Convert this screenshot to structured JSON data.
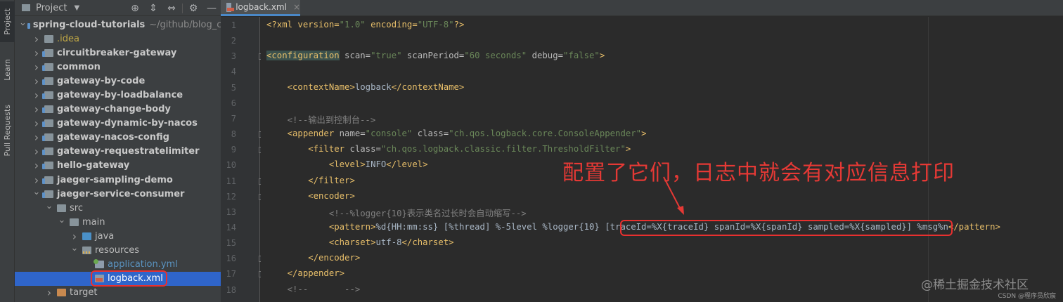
{
  "toolstrip": {
    "tabs": [
      {
        "label": "Project",
        "icon": "folder-icon"
      },
      {
        "label": "Learn",
        "icon": "graduation-cap-icon"
      },
      {
        "label": "Pull Requests",
        "icon": "pull-request-icon"
      }
    ]
  },
  "project_panel": {
    "title": "Project",
    "tree": [
      {
        "label": "spring-cloud-tutorials",
        "path": "~/github/blog_c",
        "arrow": "open",
        "depth": 0,
        "icon": "module",
        "style": "bold"
      },
      {
        "label": ".idea",
        "arrow": "closed",
        "depth": 1,
        "icon": "folder",
        "style": "idea"
      },
      {
        "label": "circuitbreaker-gateway",
        "arrow": "closed",
        "depth": 1,
        "icon": "module",
        "style": "bold"
      },
      {
        "label": "common",
        "arrow": "closed",
        "depth": 1,
        "icon": "module",
        "style": "bold"
      },
      {
        "label": "gateway-by-code",
        "arrow": "closed",
        "depth": 1,
        "icon": "module",
        "style": "bold"
      },
      {
        "label": "gateway-by-loadbalance",
        "arrow": "closed",
        "depth": 1,
        "icon": "module",
        "style": "bold"
      },
      {
        "label": "gateway-change-body",
        "arrow": "closed",
        "depth": 1,
        "icon": "module",
        "style": "bold"
      },
      {
        "label": "gateway-dynamic-by-nacos",
        "arrow": "closed",
        "depth": 1,
        "icon": "module",
        "style": "bold"
      },
      {
        "label": "gateway-nacos-config",
        "arrow": "closed",
        "depth": 1,
        "icon": "module",
        "style": "bold"
      },
      {
        "label": "gateway-requestratelimiter",
        "arrow": "closed",
        "depth": 1,
        "icon": "module",
        "style": "bold"
      },
      {
        "label": "hello-gateway",
        "arrow": "closed",
        "depth": 1,
        "icon": "module",
        "style": "bold"
      },
      {
        "label": "jaeger-sampling-demo",
        "arrow": "closed",
        "depth": 1,
        "icon": "module",
        "style": "bold"
      },
      {
        "label": "jaeger-service-consumer",
        "arrow": "open",
        "depth": 1,
        "icon": "module",
        "style": "bold"
      },
      {
        "label": "src",
        "arrow": "open",
        "depth": 2,
        "icon": "folder",
        "style": "normal"
      },
      {
        "label": "main",
        "arrow": "open",
        "depth": 3,
        "icon": "folder",
        "style": "normal"
      },
      {
        "label": "java",
        "arrow": "closed",
        "depth": 4,
        "icon": "blue",
        "style": "normal"
      },
      {
        "label": "resources",
        "arrow": "open",
        "depth": 4,
        "icon": "res",
        "style": "normal"
      },
      {
        "label": "application.yml",
        "arrow": "none",
        "depth": 5,
        "icon": "yml",
        "style": "yml"
      },
      {
        "label": "logback.xml",
        "arrow": "none",
        "depth": 5,
        "icon": "xml",
        "style": "sel",
        "selected": true
      },
      {
        "label": "target",
        "arrow": "closed",
        "depth": 2,
        "icon": "target",
        "style": "normal"
      }
    ]
  },
  "editor": {
    "tab_label": "logback.xml",
    "line_numbers": [
      "1",
      "2",
      "3",
      "4",
      "5",
      "6",
      "7",
      "8",
      "9",
      "10",
      "11",
      "12",
      "13",
      "14",
      "15",
      "16",
      "17",
      "18"
    ],
    "lines": [
      [
        [
          "<?xml version=",
          "t"
        ],
        [
          "\"1.0\"",
          "v"
        ],
        [
          " encoding=",
          "t"
        ],
        [
          "\"UTF-8\"",
          "v"
        ],
        [
          "?>",
          "t"
        ]
      ],
      [],
      [
        [
          "<configuration",
          "t hl"
        ],
        [
          " scan=",
          "a"
        ],
        [
          "\"true\"",
          "v"
        ],
        [
          " scanPeriod=",
          "a"
        ],
        [
          "\"60 seconds\"",
          "v"
        ],
        [
          " debug=",
          "a"
        ],
        [
          "\"false\"",
          "v"
        ],
        [
          ">",
          "t"
        ]
      ],
      [],
      [
        [
          "    <contextName>",
          "t"
        ],
        [
          "logback",
          "txt"
        ],
        [
          "</contextName>",
          "t"
        ]
      ],
      [],
      [
        [
          "    <!--输出到控制台-->",
          "c"
        ]
      ],
      [
        [
          "    <appender",
          "t"
        ],
        [
          " name=",
          "a"
        ],
        [
          "\"console\"",
          "v"
        ],
        [
          " class=",
          "a"
        ],
        [
          "\"ch.qos.logback.core.ConsoleAppender\"",
          "v"
        ],
        [
          ">",
          "t"
        ]
      ],
      [
        [
          "        <filter",
          "t"
        ],
        [
          " class=",
          "a"
        ],
        [
          "\"ch.qos.logback.classic.filter.ThresholdFilter\"",
          "v"
        ],
        [
          ">",
          "t"
        ]
      ],
      [
        [
          "            <level>",
          "t"
        ],
        [
          "INFO",
          "txt"
        ],
        [
          "</level>",
          "t"
        ]
      ],
      [
        [
          "        </filter>",
          "t"
        ]
      ],
      [
        [
          "        <encoder>",
          "t"
        ]
      ],
      [
        [
          "            <!--%logger{10}表示类名过长时会自动缩写-->",
          "c"
        ]
      ],
      [
        [
          "            <pattern>",
          "t"
        ],
        [
          "%d{HH:mm:ss} [%thread] %-5level %logger{10} [traceId=%X{traceId} spanId=%X{spanId} sampled=%X{sampled}] %msg%n",
          "txt"
        ],
        [
          "</pattern>",
          "t"
        ]
      ],
      [
        [
          "            <charset>",
          "t"
        ],
        [
          "utf-8",
          "txt"
        ],
        [
          "</charset>",
          "t"
        ]
      ],
      [
        [
          "        </encoder>",
          "t"
        ]
      ],
      [
        [
          "    </appender>",
          "t"
        ]
      ],
      [
        [
          "    <!--       -->",
          "c"
        ]
      ]
    ]
  },
  "annotation": {
    "text": "配置了它们，日志中就会有对应信息打印"
  },
  "watermark": {
    "juejin": "@稀土掘金技术社区",
    "csdn": "CSDN @程序员欣宸"
  }
}
